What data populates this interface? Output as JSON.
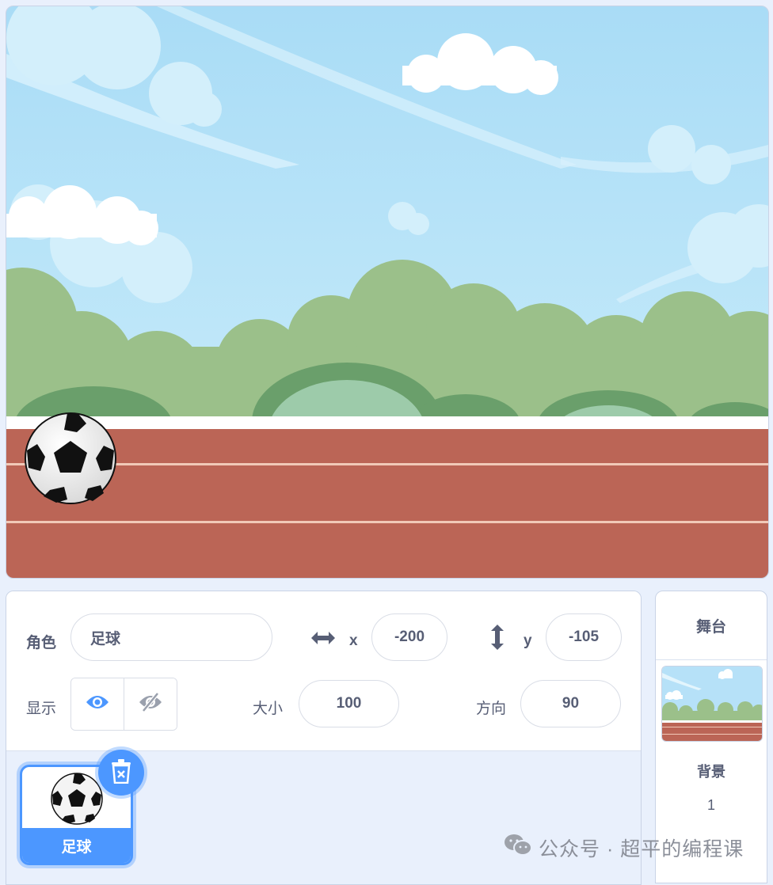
{
  "sprite_info": {
    "sprite_label": "角色",
    "sprite_name": "足球",
    "x_label": "x",
    "x_value": "-200",
    "y_label": "y",
    "y_value": "-105",
    "show_label": "显示",
    "size_label": "大小",
    "size_value": "100",
    "direction_label": "方向",
    "direction_value": "90"
  },
  "sprite_list": [
    {
      "name": "足球",
      "selected": true
    }
  ],
  "stage_selector": {
    "title": "舞台",
    "backdrops_label": "背景",
    "backdrops_count": "1"
  },
  "watermark": "公众号 · 超平的编程课",
  "icons": {
    "move_x": "horizontal-arrows-icon",
    "move_y": "vertical-arrows-icon",
    "show": "eye-icon",
    "hide": "eye-slash-icon",
    "delete": "trash-icon",
    "watermark": "wechat-icon"
  },
  "colors": {
    "accent": "#4c97ff",
    "panel_bg": "#e9f0fc",
    "text": "#575e75"
  }
}
